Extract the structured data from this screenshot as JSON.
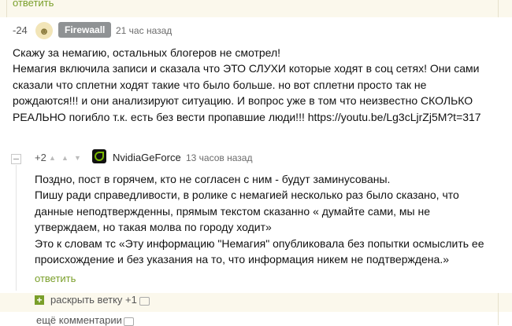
{
  "top": {
    "reply_label": "ответить"
  },
  "comment1": {
    "rating": "-24",
    "avatar_icon": "avatar-placeholder",
    "username": "Firewaall",
    "time": "21 час назад",
    "lines": [
      "Скажу за немагию, остальных блогеров не смотрел!",
      "Немагия включила записи и сказала что ЭТО СЛУХИ которые ходят в соц сетях! Они сами",
      "сказали что сплетни ходят такие что было больше. но вот сплетни  просто так не",
      "рождаются!!! и они анализируют ситуацию.  И вопрос уже в том что неизвестно СКОЛЬКО",
      "РЕАЛЬНО погибло т.к. есть без вести пропавшие люди!!! https://youtu.be/Lg3cLjrZj5M?t=317"
    ]
  },
  "comment2": {
    "rating": "+2",
    "username": "NvidiaGeForce",
    "time": "13 часов назад",
    "lines": [
      "Поздно, пост в горячем, кто не согласен с ним - будут заминусованы.",
      "Пишу ради справедливости, в ролике с немагией несколько раз было сказано, что",
      "данные неподтвержденны,  прямым текстом сказанно « думайте сами, мы не",
      "утверждаем, но такая молва по городу ходит»",
      "Это к словам тс «Эту информацию \"Немагия\" опубликовала без попытки осмыслить ее",
      "происхождение и без указания на то, что информация никем не подтверждена.»"
    ],
    "reply_label": "ответить"
  },
  "expand": {
    "label": "раскрыть ветку +1"
  },
  "more": {
    "label": "ещё комментарии"
  },
  "colors": {
    "link_green": "#7a9f2a",
    "strip_bg": "#fbf8ec",
    "badge_gray": "#8f9294"
  }
}
